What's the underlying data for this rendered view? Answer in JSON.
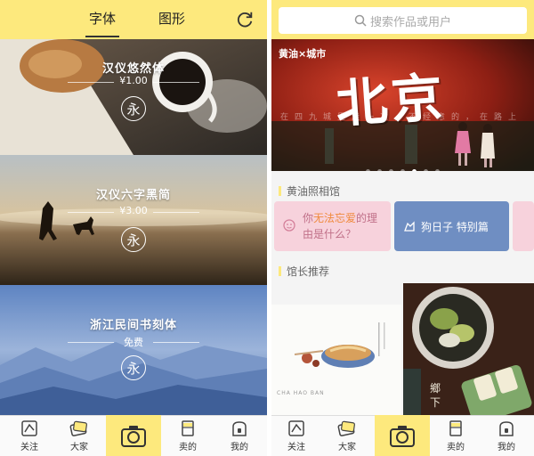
{
  "left_screen": {
    "tabs": [
      {
        "label": "字体"
      },
      {
        "label": "图形"
      }
    ],
    "fonts": [
      {
        "name": "汉仪悠然体",
        "price": "¥1.00",
        "sample": "永"
      },
      {
        "name": "汉仪六字黑简",
        "price": "¥3.00",
        "sample": "永"
      },
      {
        "name": "浙江民间书刻体",
        "price": "免费",
        "sample": "永"
      }
    ]
  },
  "right_screen": {
    "search_placeholder": "搜索作品或用户",
    "banner": {
      "tag": "黄油×城市",
      "headline": "北京",
      "subline": "在四九城里走一次，不经意的，在路上",
      "total_slides": 7,
      "active_slide_index": 4
    },
    "section_photo": "黄油照相馆",
    "tiles": [
      {
        "text_plain_1": "你",
        "text_highlight": "无法忘爱",
        "text_plain_2": "的理",
        "text_line2": "由是什么？"
      },
      {
        "text": "狗日子 特别篇"
      }
    ],
    "section_recommend": "馆长推荐",
    "recommend_caption": "CHA HAO BAN",
    "side_poem": "鄉 下"
  },
  "bottom_nav": {
    "items": [
      {
        "label": "关注",
        "icon": "follow-icon"
      },
      {
        "label": "大家",
        "icon": "everyone-icon"
      },
      {
        "label": "卖的",
        "icon": "shop-icon"
      },
      {
        "label": "我的",
        "icon": "profile-icon"
      }
    ],
    "camera_icon": "camera-icon"
  },
  "colors": {
    "accent_yellow": "#fde97d",
    "highlight_orange": "#f08a3c"
  }
}
